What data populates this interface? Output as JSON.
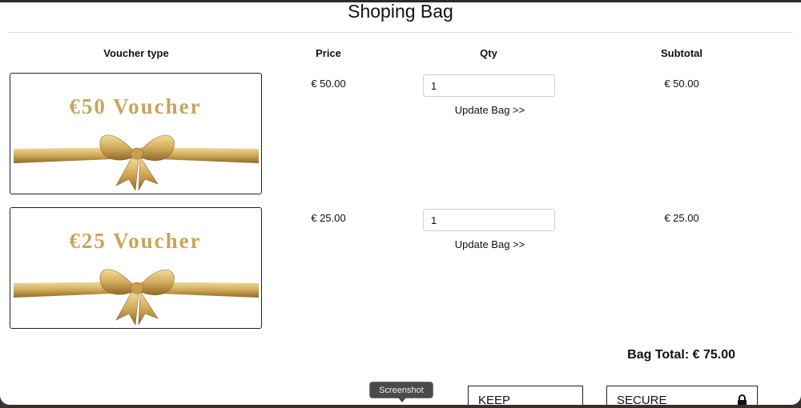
{
  "page": {
    "title": "Shoping Bag"
  },
  "table": {
    "headers": {
      "voucher_type": "Voucher type",
      "price": "Price",
      "qty": "Qty",
      "subtotal": "Subtotal"
    },
    "rows": [
      {
        "voucher_caption": "€50 Voucher",
        "price": "€ 50.00",
        "qty": "1",
        "update_label": "Update Bag >>",
        "subtotal": "€ 50.00"
      },
      {
        "voucher_caption": "€25 Voucher",
        "price": "€ 25.00",
        "qty": "1",
        "update_label": "Update Bag >>",
        "subtotal": "€ 25.00"
      }
    ]
  },
  "summary": {
    "bag_total": "Bag Total: € 75.00"
  },
  "actions": {
    "keep_shopping": "KEEP SHOPPING",
    "secure_checkout": "SECURE CHECKOUT"
  },
  "tooltip": {
    "text": "Screenshot"
  },
  "icons": {
    "lock": "lock-icon",
    "ribbon": "gold-bow-ribbon"
  },
  "colors": {
    "gold": "#c9a55a",
    "text": "#111111",
    "border": "#222222"
  }
}
